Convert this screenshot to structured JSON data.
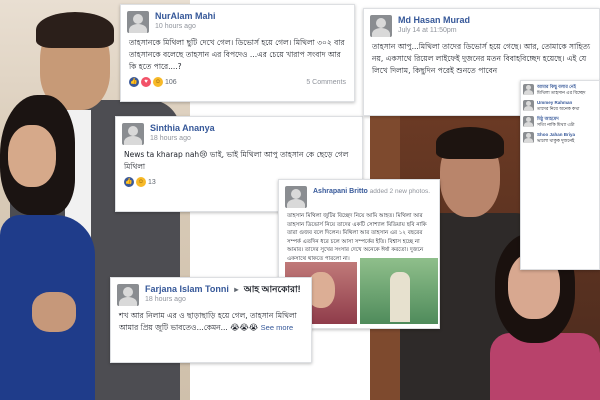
{
  "posts": {
    "nuralam": {
      "name": "NurAlam Mahi",
      "time": "10 hours ago",
      "text": "তাহসানকে মিথিলা ছুটি দেখে গেল। ডিভোর্স হয়ে গেল। মিথিলা ৩০২ বার তাহসানকে বলেছে তাহসান এর বিপদেও ...এর চেয়ে খারাপ সংবাদ আর কি হতে পারে....?",
      "reaction_count": "106",
      "comments": "5 Comments"
    },
    "sinthia": {
      "name": "Sinthia Ananya",
      "time": "18 hours ago",
      "text_start": "News ta kharap nah",
      "text_rest": " ভাই, ভাই মিথিলা আপু তাহসান কে ছেড়ে গেল মিথিলা",
      "highlight": "মিথিলা",
      "reaction_count": "13"
    },
    "farjana": {
      "name": "Farjana Islam Tonni",
      "feeling": "আহ আনকোরা!",
      "time": "18 hours ago",
      "text": "শখ আর নিলাম এর ও ছাড়াছাড়ি হয়ে গেল, তাহসান মিথিলা আমার প্রিয় জুটি ভাবতেও...কেমন...",
      "see_more": "See more"
    },
    "hasan": {
      "name": "Md Hasan Murad",
      "time": "July 14 at 11:50pm",
      "text": "তাহসান আপু...মিথিলা তাদের ডিভোর্স হয়ে গেছে। আর, তোমাকে সাহিত্য নয়, একসাথে রিয়েল লাইফেই দুজনের মতন বিবাহবিচ্ছেদ হয়েছে। এই যে লিখে দিলাম, কিছুদিন পরেই শুনতে পাবেন"
    },
    "ashrapani": {
      "name": "Ashrapani Britto",
      "action": "added 2 new photos.",
      "text": "তাহসান মিথিলা জুটির বিচ্ছেদ নিয়ে আমি আহত। মিথিলা আর তাহসান ডিভোর্স নিয়ে তাদের একটি সোশ্যাল মিডিয়ায় ছবি নাকি তারা গুজব বলে দিলেন। মিথিলা আর তাহসান এর ১২ বছরের সম্পর্ক এতদিন ধরে চলে আসা সম্পর্কের ইতি। বিশ্বাস হচ্ছে না আমার। তাদের সুখের সংসার দেখে অনেকে ঈর্ষা করতো। দুজনে একসাথে থাকতে পারলো না।"
    }
  },
  "comment_list": [
    {
      "name": "আমার কিছু বলার নেই",
      "text": "মিথিলা তাহসান এর বিচ্ছেদ"
    },
    {
      "name": "Ummey Rahman",
      "text": "তাদের নিয়ে অনেক কথা"
    },
    {
      "name": "মিঠু আহমেদ",
      "text": "সত্যি নাকি মিথ্যা এটা"
    },
    {
      "name": "Shoo Jahan Briya",
      "text": "ভালো থাকুক দুজনেই"
    }
  ],
  "icons": {
    "like": "like-icon",
    "love": "love-icon",
    "haha": "haha-icon"
  }
}
